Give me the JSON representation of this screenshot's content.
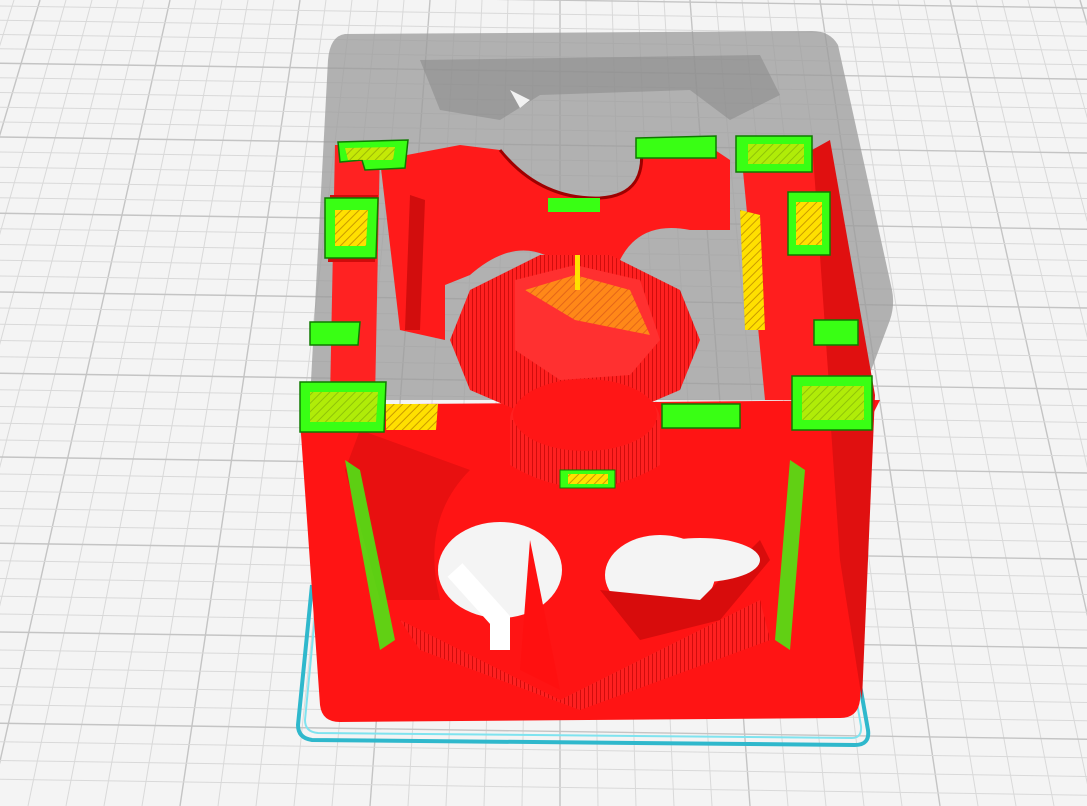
{
  "viewport": {
    "view": "layer-preview",
    "colors": {
      "background": "#f4f4f4",
      "grid_minor": "#d9d9d9",
      "grid_major": "#c4c4c4",
      "model_shadow": "#9a9a9a",
      "wall": "#ff1a1a",
      "wall_dark": "#d40d0d",
      "infill": "#ffea00",
      "top_skin": "#39ff14",
      "brim": "#37c6d8"
    },
    "icons": {
      "build_plate": "grid-plate-icon",
      "model": "cube-model-icon",
      "brim": "skirt-brim-icon"
    }
  }
}
